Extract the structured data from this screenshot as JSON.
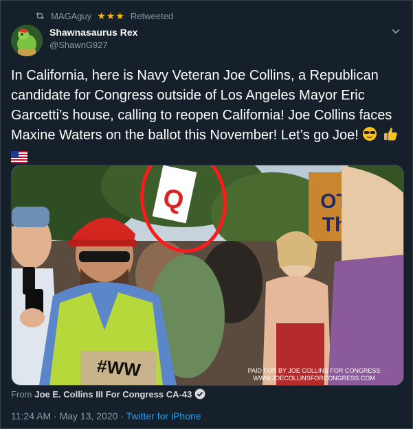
{
  "retweet": {
    "user": "MAGAguy",
    "stars": "★★★",
    "label": "Retweeted"
  },
  "author": {
    "name": "Shawnasaurus Rex",
    "handle": "@ShawnG927"
  },
  "tweet": {
    "text": "In California, here is Navy Veteran Joe Collins, a Republican candidate for Congress outside of Los Angeles Mayor Eric Garcetti’s house, calling to reopen California! Joe Collins faces Maxine Waters on the ballot this November! Let’s go Joe!",
    "emojis": [
      "sunglasses-emoji",
      "thumbs-up-emoji",
      "us-flag-emoji"
    ]
  },
  "media": {
    "overlay_line1": "PAID FOR BY JOE COLLINS FOR CONGRESS",
    "overlay_line2": "WWW.JOECOLLINSFORCONGRESS.COM",
    "sign_letter": "Q",
    "shirt_text": "#WW"
  },
  "source": {
    "prefix": "From",
    "name": "Joe E. Collins III For Congress CA-43"
  },
  "meta": {
    "time": "11:24 AM",
    "date": "May 13, 2020",
    "separator": "·",
    "client": "Twitter for iPhone"
  },
  "colors": {
    "background": "#15202b",
    "secondary_text": "#8899a6",
    "link": "#1da1f2",
    "star": "#f4b400"
  }
}
